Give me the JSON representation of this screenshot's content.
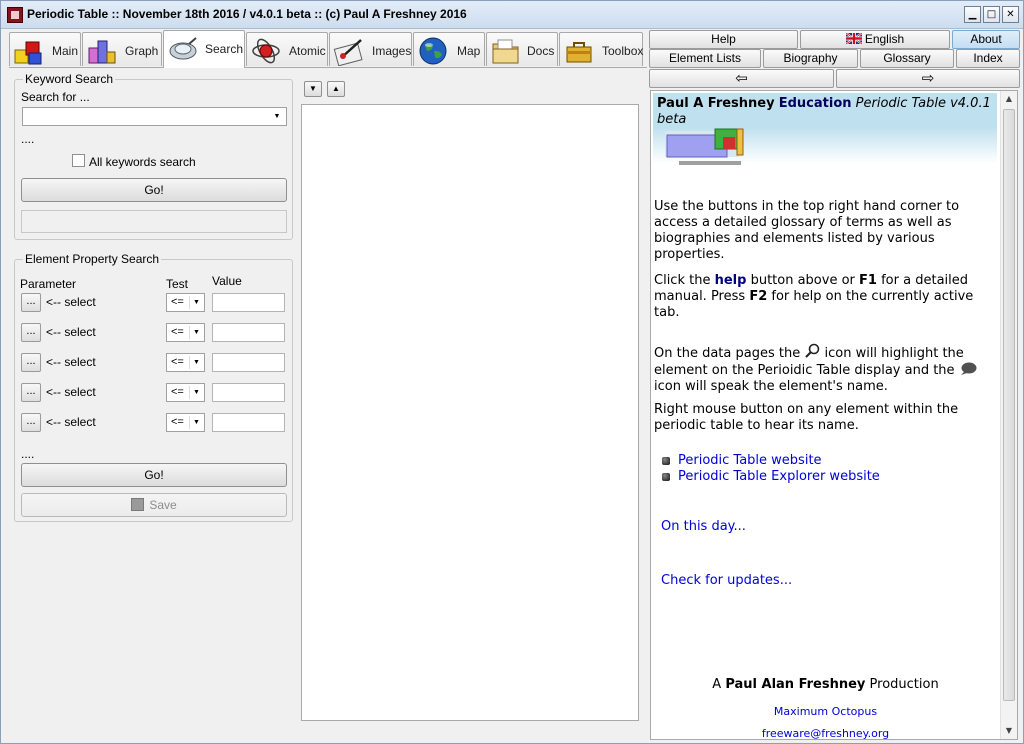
{
  "window": {
    "title": "Periodic Table :: November 18th 2016 / v4.0.1 beta :: (c) Paul A Freshney 2016",
    "controls": {
      "minimize": "▁",
      "maximize": "□",
      "close": "✕"
    }
  },
  "tabs": [
    {
      "label": "Main",
      "icon": "blocks-icon"
    },
    {
      "label": "Graph",
      "icon": "graph-icon"
    },
    {
      "label": "Search",
      "icon": "magnifier-icon",
      "active": true
    },
    {
      "label": "Atomic",
      "icon": "atom-icon"
    },
    {
      "label": "Images",
      "icon": "images-icon"
    },
    {
      "label": "Map",
      "icon": "globe-icon"
    },
    {
      "label": "Docs",
      "icon": "folder-icon"
    },
    {
      "label": "Toolbox",
      "icon": "toolbox-icon"
    }
  ],
  "keyword_search": {
    "title": "Keyword Search",
    "search_for_label": "Search for ...",
    "search_value": "",
    "status": "....",
    "all_keywords_label": "All keywords search",
    "all_keywords_checked": false,
    "go_label": "Go!",
    "result_value": ""
  },
  "property_search": {
    "title": "Element Property Search",
    "col_parameter": "Parameter",
    "col_test": "Test",
    "col_value": "Value",
    "rows": [
      {
        "button": "...",
        "label": "<-- select",
        "test": "<=",
        "value": ""
      },
      {
        "button": "...",
        "label": "<-- select",
        "test": "<=",
        "value": ""
      },
      {
        "button": "...",
        "label": "<-- select",
        "test": "<=",
        "value": ""
      },
      {
        "button": "...",
        "label": "<-- select",
        "test": "<=",
        "value": ""
      },
      {
        "button": "...",
        "label": "<-- select",
        "test": "<=",
        "value": ""
      }
    ],
    "status": "....",
    "go_label": "Go!",
    "save_label": "Save"
  },
  "center": {
    "down_arrow": "▼",
    "up_arrow": "▲"
  },
  "right_nav": {
    "help": "Help",
    "english": "English",
    "about": "About",
    "element_lists": "Element Lists",
    "biography": "Biography",
    "glossary": "Glossary",
    "index": "Index",
    "back": "⇦",
    "forward": "⇨"
  },
  "info": {
    "banner_name": "Paul A Freshney",
    "banner_edu": "Education",
    "banner_product": "Periodic Table v4.0.1 beta",
    "p1": "Use the buttons in the top right hand corner to access a detailed glossary of terms as well as biographies and elements listed by various properties.",
    "p2_a": "Click the",
    "p2_help": "help",
    "p2_b": "button above or",
    "p2_f1": "F1",
    "p2_c": "for a detailed manual. Press",
    "p2_f2": "F2",
    "p2_d": "for help on the currently active tab.",
    "p3_a": "On the data pages the",
    "p3_b": "icon will highlight the element on the Perioidic Table display and the",
    "p3_c": "icon will speak the element's name.",
    "p4": "Right mouse button on any element within the periodic table to hear its name.",
    "link_website": "Periodic Table website",
    "link_explorer": "Periodic Table Explorer website",
    "on_this_day": "On this day...",
    "check_updates": "Check for updates...",
    "production_a": "A",
    "production_name": "Paul Alan Freshney",
    "production_b": "Production",
    "company": "Maximum Octopus",
    "email": "freeware@freshney.org"
  }
}
